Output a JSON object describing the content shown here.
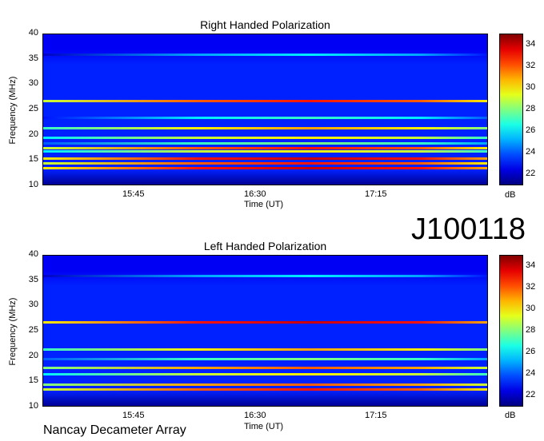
{
  "chart_data": [
    {
      "type": "heatmap",
      "title": "Right Handed Polarization",
      "xlabel": "Time (UT)",
      "ylabel": "Frequency (MHz)",
      "x_ticks": [
        "15:45",
        "16:30",
        "17:15"
      ],
      "y_ticks": [
        10,
        15,
        20,
        25,
        30,
        35,
        40
      ],
      "ylim": [
        10,
        40
      ],
      "colorbar": {
        "label": "dB",
        "ticks": [
          22,
          24,
          26,
          28,
          30,
          32,
          34
        ],
        "range": [
          21,
          35
        ]
      },
      "bands": [
        {
          "freq": 13.5,
          "level": 34
        },
        {
          "freq": 14.5,
          "level": 33
        },
        {
          "freq": 15.5,
          "level": 34
        },
        {
          "freq": 16.8,
          "level": 30
        },
        {
          "freq": 17.5,
          "level": 33
        },
        {
          "freq": 18.5,
          "level": 28
        },
        {
          "freq": 19.5,
          "level": 30
        },
        {
          "freq": 21.5,
          "level": 31
        },
        {
          "freq": 23.5,
          "level": 27
        },
        {
          "freq": 26.8,
          "level": 33
        },
        {
          "freq": 36,
          "level": 26
        }
      ]
    },
    {
      "type": "heatmap",
      "title": "Left Handed Polarization",
      "xlabel": "Time (UT)",
      "ylabel": "Frequency (MHz)",
      "x_ticks": [
        "15:45",
        "16:30",
        "17:15"
      ],
      "y_ticks": [
        10,
        15,
        20,
        25,
        30,
        35,
        40
      ],
      "ylim": [
        10,
        40
      ],
      "colorbar": {
        "label": "dB",
        "ticks": [
          22,
          24,
          26,
          28,
          30,
          32,
          34
        ],
        "range": [
          21,
          35
        ]
      },
      "bands": [
        {
          "freq": 13.5,
          "level": 33
        },
        {
          "freq": 14.5,
          "level": 32
        },
        {
          "freq": 16.5,
          "level": 30
        },
        {
          "freq": 17.8,
          "level": 32
        },
        {
          "freq": 19.5,
          "level": 28
        },
        {
          "freq": 21.5,
          "level": 31
        },
        {
          "freq": 26.8,
          "level": 34
        },
        {
          "freq": 36,
          "level": 26
        }
      ]
    }
  ],
  "figure": {
    "code": "J100118",
    "footer": "Nancay Decameter Array"
  }
}
